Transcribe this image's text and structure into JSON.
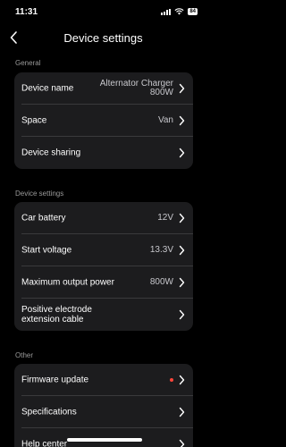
{
  "status_bar": {
    "time": "11:31",
    "battery": "84"
  },
  "header": {
    "title": "Device settings"
  },
  "sections": [
    {
      "label": "General",
      "rows": [
        {
          "label": "Device name",
          "value": "Alternator Charger 800W"
        },
        {
          "label": "Space",
          "value": "Van"
        },
        {
          "label": "Device sharing",
          "value": ""
        }
      ]
    },
    {
      "label": "Device settings",
      "rows": [
        {
          "label": "Car battery",
          "value": "12V"
        },
        {
          "label": "Start voltage",
          "value": "13.3V"
        },
        {
          "label": "Maximum output power",
          "value": "800W"
        },
        {
          "label": "Positive electrode extension cable",
          "value": ""
        }
      ]
    },
    {
      "label": "Other",
      "rows": [
        {
          "label": "Firmware update",
          "value": "",
          "badge": "update-dot"
        },
        {
          "label": "Specifications",
          "value": ""
        },
        {
          "label": "Help center",
          "value": ""
        }
      ]
    }
  ],
  "icons": {
    "back": "chevron-left-icon",
    "row": "chevron-right-icon"
  },
  "colors": {
    "background": "#000000",
    "card": "#1c1c1e",
    "badge": "#ff453a"
  }
}
